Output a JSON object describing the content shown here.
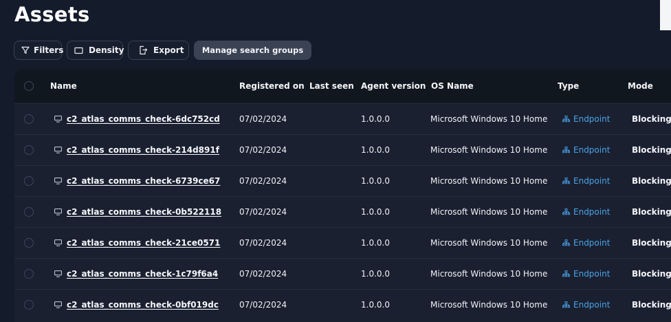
{
  "page": {
    "title": "Assets"
  },
  "toolbar": {
    "filters_label": "Filters",
    "density_label": "Density",
    "export_label": "Export",
    "manage_label": "Manage search groups"
  },
  "table": {
    "columns": [
      "Name",
      "Registered on",
      "Last seen",
      "Agent version",
      "OS Name",
      "Type",
      "Mode"
    ],
    "rows": [
      {
        "name": "c2_atlas_comms_check-6dc752cd",
        "registered_on": "07/02/2024",
        "last_seen": "",
        "agent_version": "1.0.0.0",
        "os_name": "Microsoft Windows 10 Home",
        "type": "Endpoint",
        "mode": "Blocking"
      },
      {
        "name": "c2_atlas_comms_check-214d891f",
        "registered_on": "07/02/2024",
        "last_seen": "",
        "agent_version": "1.0.0.0",
        "os_name": "Microsoft Windows 10 Home",
        "type": "Endpoint",
        "mode": "Blocking"
      },
      {
        "name": "c2_atlas_comms_check-6739ce67",
        "registered_on": "07/02/2024",
        "last_seen": "",
        "agent_version": "1.0.0.0",
        "os_name": "Microsoft Windows 10 Home",
        "type": "Endpoint",
        "mode": "Blocking"
      },
      {
        "name": "c2_atlas_comms_check-0b522118",
        "registered_on": "07/02/2024",
        "last_seen": "",
        "agent_version": "1.0.0.0",
        "os_name": "Microsoft Windows 10 Home",
        "type": "Endpoint",
        "mode": "Blocking"
      },
      {
        "name": "c2_atlas_comms_check-21ce0571",
        "registered_on": "07/02/2024",
        "last_seen": "",
        "agent_version": "1.0.0.0",
        "os_name": "Microsoft Windows 10 Home",
        "type": "Endpoint",
        "mode": "Blocking"
      },
      {
        "name": "c2_atlas_comms_check-1c79f6a4",
        "registered_on": "07/02/2024",
        "last_seen": "",
        "agent_version": "1.0.0.0",
        "os_name": "Microsoft Windows 10 Home",
        "type": "Endpoint",
        "mode": "Blocking"
      },
      {
        "name": "c2_atlas_comms_check-0bf019dc",
        "registered_on": "07/02/2024",
        "last_seen": "",
        "agent_version": "1.0.0.0",
        "os_name": "Microsoft Windows 10 Home",
        "type": "Endpoint",
        "mode": "Blocking"
      }
    ]
  },
  "icons": {
    "filters": "filter-icon",
    "density": "density-icon",
    "export": "export-icon",
    "row_name": "computer-icon",
    "type": "endpoint-network-icon"
  },
  "colors": {
    "background": "#141b2b",
    "table_body": "#1a2030",
    "table_header": "#11171f",
    "accent_link": "#4aa3e8",
    "manage_button": "#3b4253"
  }
}
